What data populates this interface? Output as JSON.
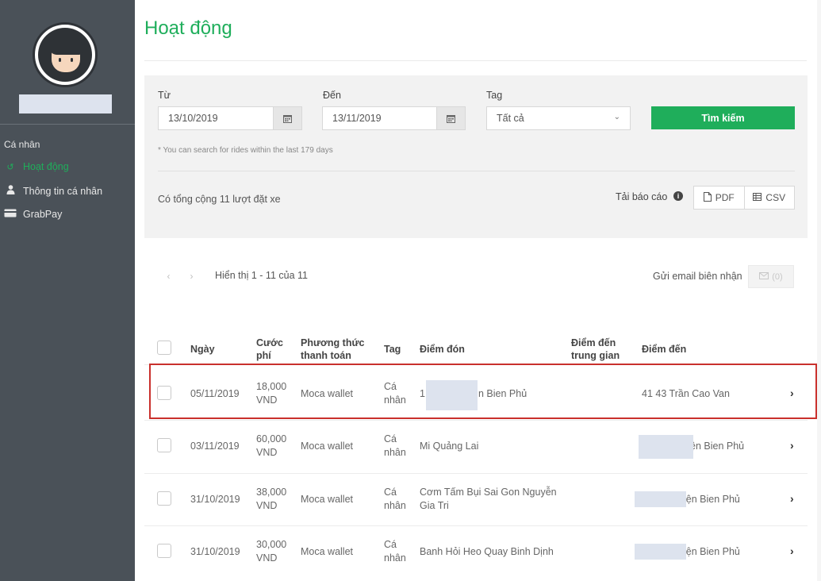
{
  "sidebar": {
    "section_label": "Cá nhân",
    "items": [
      {
        "label": "Hoạt động",
        "icon": "history-icon",
        "active": true
      },
      {
        "label": "Thông tin cá nhân",
        "icon": "user-icon",
        "active": false
      },
      {
        "label": "GrabPay",
        "icon": "credit-card-icon",
        "active": false
      }
    ]
  },
  "page": {
    "title": "Hoạt động"
  },
  "filters": {
    "from_label": "Từ",
    "from_value": "13/10/2019",
    "to_label": "Đến",
    "to_value": "13/11/2019",
    "tag_label": "Tag",
    "tag_value": "Tất cả",
    "search_button": "Tìm kiếm",
    "hint": "* You can search for rides within the last 179 days",
    "total_text": "Có tổng cộng 11 lượt đặt xe",
    "report_label": "Tải báo cáo",
    "pdf_label": "PDF",
    "csv_label": "CSV"
  },
  "list_controls": {
    "prev": "‹",
    "next": "›",
    "showing": "Hiển thị 1 - 11 của 11",
    "email_label": "Gửi email biên nhận",
    "email_count": "(0)"
  },
  "table": {
    "headers": {
      "date": "Ngày",
      "fare_1": "Cước",
      "fare_2": "phí",
      "payment_1": "Phương thức",
      "payment_2": "thanh toán",
      "tag": "Tag",
      "pickup": "Điểm đón",
      "stop_1": "Điểm đến",
      "stop_2": "trung gian",
      "dropoff": "Điểm đến"
    },
    "rows": [
      {
        "date": "05/11/2019",
        "fare_1": "18,000",
        "fare_2": "VND",
        "payment": "Moca wallet",
        "tag_1": "Cá",
        "tag_2": "nhân",
        "pickup_1": "1",
        "pickup_2": "n Bien Phủ",
        "dropoff": "41 43 Trần Cao Van"
      },
      {
        "date": "03/11/2019",
        "fare_1": "60,000",
        "fare_2": "VND",
        "payment": "Moca wallet",
        "tag_1": "Cá",
        "tag_2": "nhân",
        "pickup_1": "Mi Quảng Lai",
        "pickup_2": "",
        "dropoff": "ện Bien Phủ"
      },
      {
        "date": "31/10/2019",
        "fare_1": "38,000",
        "fare_2": "VND",
        "payment": "Moca wallet",
        "tag_1": "Cá",
        "tag_2": "nhân",
        "pickup_1": "Cơm Tấm Bụi Sai Gon Nguyễn",
        "pickup_2": "Gia Tri",
        "dropoff": "iện Bien Phủ"
      },
      {
        "date": "31/10/2019",
        "fare_1": "30,000",
        "fare_2": "VND",
        "payment": "Moca wallet",
        "tag_1": "Cá",
        "tag_2": "nhân",
        "pickup_1": "Banh Hỏi Heo Quay Binh Dịnh",
        "pickup_2": "",
        "dropoff": "iện Bien Phủ"
      }
    ]
  },
  "colors": {
    "accent": "#1fae5b",
    "sidebar_bg": "#4a5158",
    "highlight": "#c9302c"
  }
}
